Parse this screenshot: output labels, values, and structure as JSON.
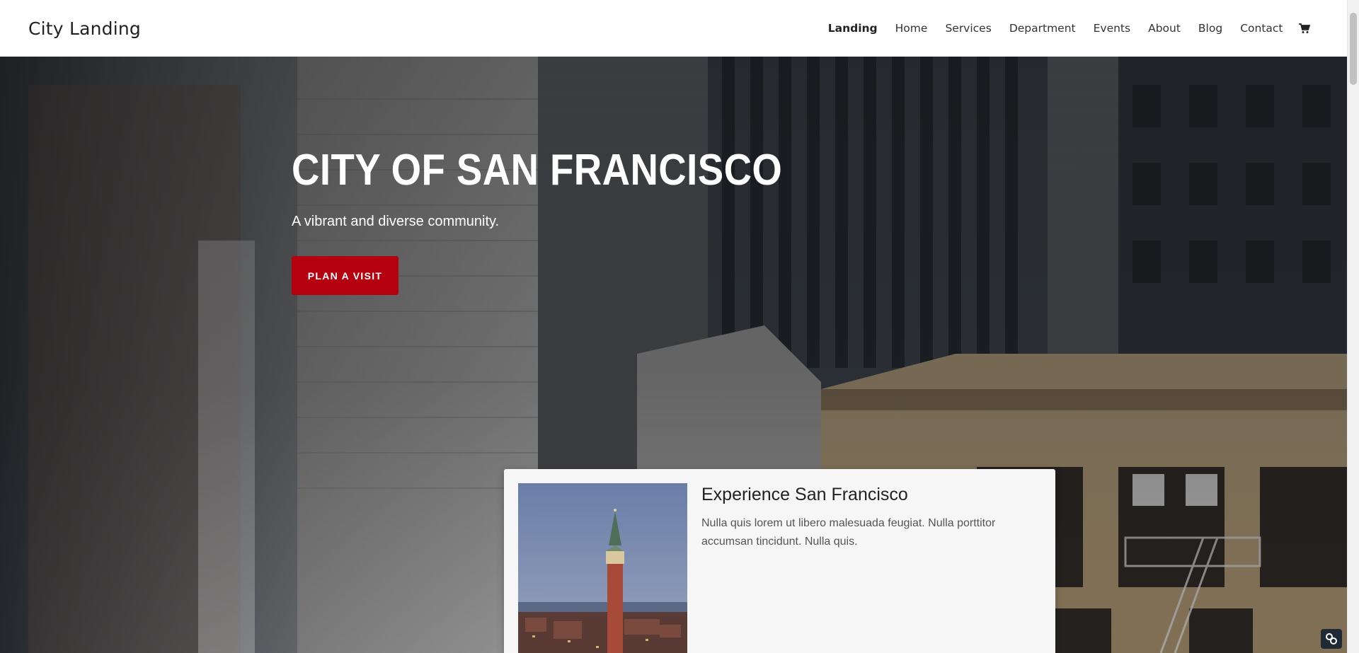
{
  "site": {
    "logo": "City Landing"
  },
  "nav": {
    "items": [
      {
        "label": "Landing",
        "active": true
      },
      {
        "label": "Home"
      },
      {
        "label": "Services"
      },
      {
        "label": "Department"
      },
      {
        "label": "Events"
      },
      {
        "label": "About"
      },
      {
        "label": "Blog"
      },
      {
        "label": "Contact"
      }
    ],
    "cart_icon": "cart-icon"
  },
  "hero": {
    "title": "CITY OF SAN FRANCISCO",
    "subtitle": "A vibrant and diverse community.",
    "cta_label": "PLAN A VISIT"
  },
  "card": {
    "title": "Experience San Francisco",
    "text": "Nulla quis lorem ut libero malesuada feugiat. Nulla porttitor accumsan tincidunt. Nulla quis."
  },
  "colors": {
    "accent": "#b5000f",
    "header_bg": "#ffffff",
    "card_bg": "#f6f6f6"
  }
}
